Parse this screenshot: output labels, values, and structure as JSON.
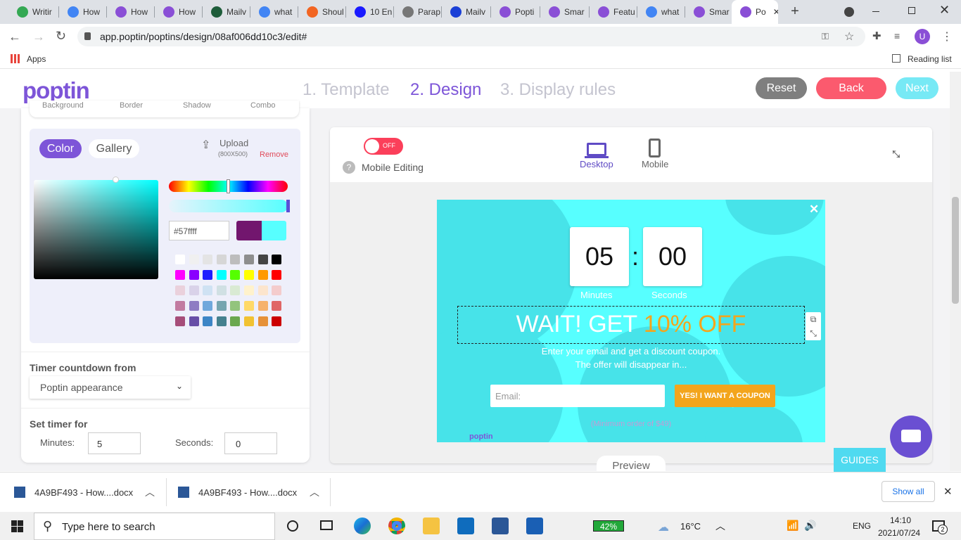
{
  "browser": {
    "tabs": [
      {
        "label": "Writir",
        "color": "#34a853"
      },
      {
        "label": "How",
        "color": "#4285f4"
      },
      {
        "label": "How",
        "color": "#8a4fd6"
      },
      {
        "label": "How",
        "color": "#8a4fd6"
      },
      {
        "label": "Mailv",
        "color": "#1e5d3a"
      },
      {
        "label": "what",
        "color": "#4285f4"
      },
      {
        "label": "Shoul",
        "color": "#f26522"
      },
      {
        "label": "10 En",
        "color": "#1a1aff"
      },
      {
        "label": "Parap",
        "color": "#777777"
      },
      {
        "label": "Mailv",
        "color": "#1a3fd6"
      },
      {
        "label": "Popti",
        "color": "#8a4fd6"
      },
      {
        "label": "Smar",
        "color": "#8a4fd6"
      },
      {
        "label": "Featu",
        "color": "#8a4fd6"
      },
      {
        "label": "what",
        "color": "#4285f4"
      },
      {
        "label": "Smar",
        "color": "#8a4fd6"
      },
      {
        "label": "Po",
        "color": "#8a4fd6",
        "active": true
      }
    ],
    "url": "app.poptin/poptins/design/08af006dd10c3/edit#",
    "url_display": "app.poptin/poptins/design/08af006dd10c3/edit#",
    "bookmarks_apps": "Apps",
    "reading_list": "Reading list",
    "profile_initial": "U"
  },
  "header": {
    "logo": "poptin",
    "steps": [
      "1. Template",
      "2. Design",
      "3. Display rules"
    ],
    "reset": "Reset",
    "back": "Back",
    "next": "Next"
  },
  "left": {
    "subtabs": [
      "Background",
      "Border",
      "Shadow",
      "Combo"
    ],
    "color_tab": "Color",
    "gallery_tab": "Gallery",
    "upload": "Upload",
    "upload_size": "(800X500)",
    "remove": "Remove",
    "hex_value": "#57ffff",
    "timer_countdown_label": "Timer countdown from",
    "timer_countdown_value": "Poptin appearance",
    "set_timer_label": "Set timer for",
    "minutes_label": "Minutes:",
    "minutes_value": "5",
    "seconds_label": "Seconds:",
    "seconds_value": "0",
    "swatches": [
      [
        "#ffffff",
        "#f0f0f0",
        "#e4e4e4",
        "#d6d6d6",
        "#bdbdbd",
        "#8e8e8e",
        "#444444",
        "#000000"
      ],
      [
        "#ff00ff",
        "#8a00ff",
        "#1e1eff",
        "#00ffff",
        "#55ff00",
        "#ffff00",
        "#ff9900",
        "#ff0000"
      ],
      [
        "#ead1dc",
        "#d9d2e9",
        "#cfe2f3",
        "#d0e0e3",
        "#d9ead3",
        "#fff2cc",
        "#fce5cd",
        "#f4cccc"
      ],
      [
        "#c27ba0",
        "#8e7cc3",
        "#6fa8dc",
        "#76a5af",
        "#93c47d",
        "#ffd966",
        "#f6b26b",
        "#e06666"
      ],
      [
        "#a64d79",
        "#674ea7",
        "#3d85c6",
        "#45818e",
        "#6aa84f",
        "#f1c232",
        "#e69138",
        "#cc0000"
      ]
    ]
  },
  "editor": {
    "toggle": "OFF",
    "mobile_editing": "Mobile Editing",
    "desktop": "Desktop",
    "mobile": "Mobile",
    "preview": "Preview",
    "guides": "GUIDES"
  },
  "popup": {
    "minutes_digits": "05",
    "seconds_digits": "00",
    "minutes_caption": "Minutes",
    "seconds_caption": "Seconds",
    "headline_a": "WAIT! GET ",
    "headline_b": "10% OFF",
    "sub1": "Enter your email and get a discount coupon.",
    "sub2": "The offer will disappear in...",
    "email_placeholder": "Email:",
    "cta": "YES! I WANT A COUPON",
    "fine_print": "(Minimum order of $49)",
    "brand": "poptin",
    "bg_color": "#57ffff",
    "accent": "#f3a51c"
  },
  "downloads": {
    "items": [
      "4A9BF493 - How....docx",
      "4A9BF493 - How....docx"
    ],
    "show_all": "Show all"
  },
  "taskbar": {
    "search": "Type here to search",
    "battery": "42%",
    "temp": "16°C",
    "lang": "ENG",
    "time": "14:10",
    "date": "2021/07/24",
    "notif_count": "2"
  }
}
